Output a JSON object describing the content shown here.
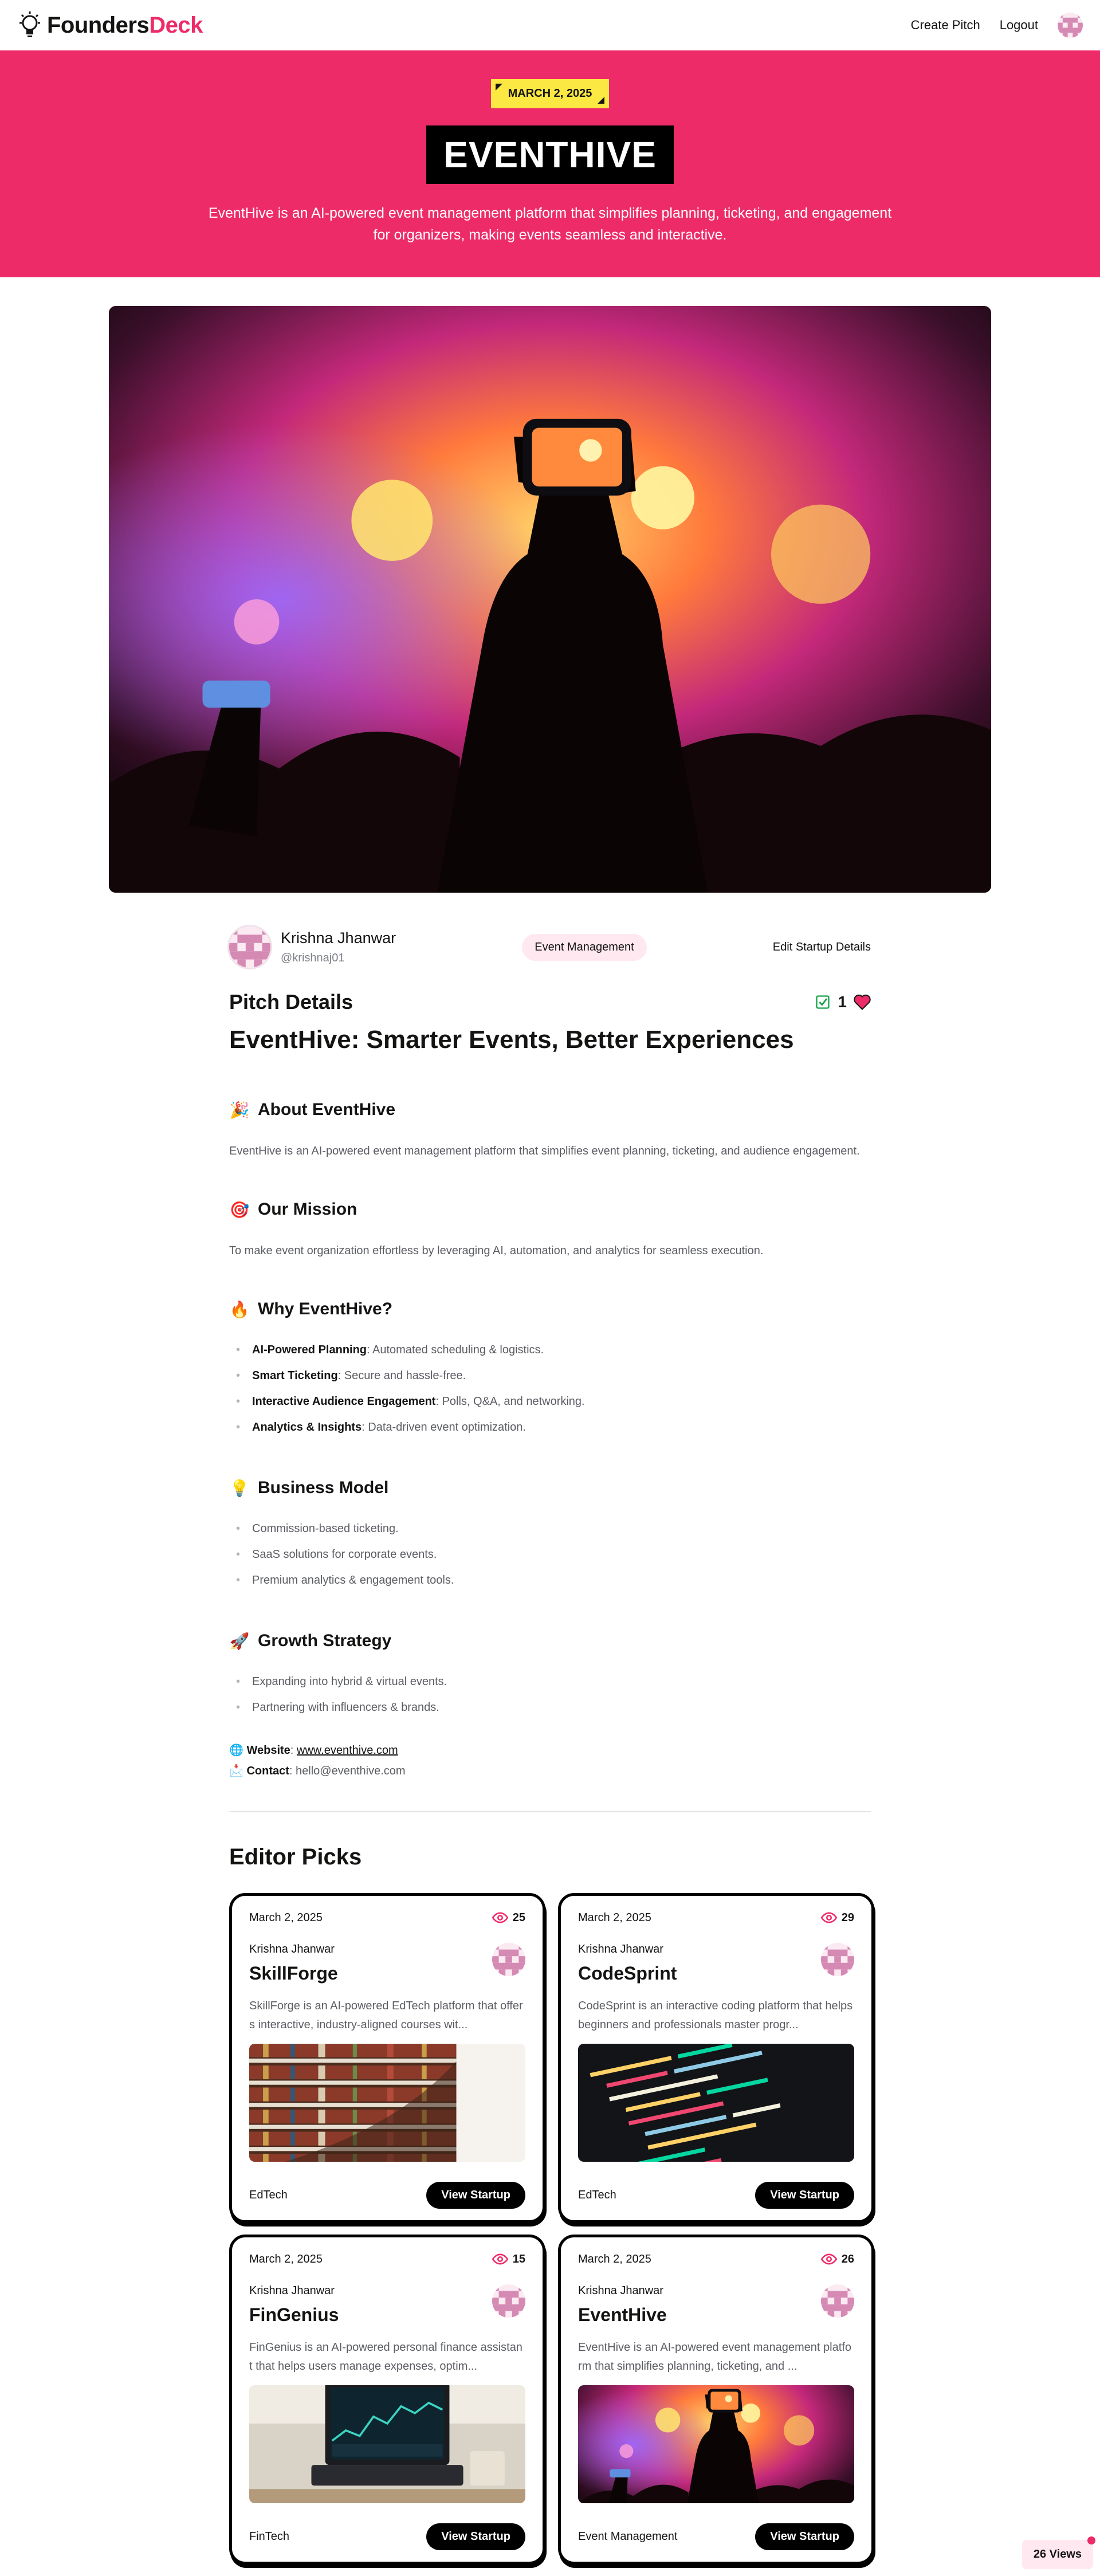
{
  "nav": {
    "logo_part1": "Founders",
    "logo_part2": "Deck",
    "create_pitch": "Create Pitch",
    "logout": "Logout"
  },
  "hero": {
    "date": "MARCH 2, 2025",
    "title": "EVENTHIVE",
    "description": "EventHive is an AI-powered event management platform that simplifies planning, ticketing, and engagement for organizers, making events seamless and interactive."
  },
  "author": {
    "name": "Krishna Jhanwar",
    "handle": "@krishnaj01",
    "category": "Event Management",
    "edit_label": "Edit Startup Details"
  },
  "pitch": {
    "heading": "Pitch Details",
    "likes": "1",
    "title": "EventHive: Smarter Events, Better Experiences",
    "about": {
      "emoji": "🎉",
      "title": "About EventHive",
      "text": "EventHive is an AI-powered event management platform that simplifies event planning, ticketing, and audience engagement."
    },
    "mission": {
      "emoji": "🎯",
      "title": "Our Mission",
      "text": "To make event organization effortless by leveraging AI, automation, and analytics for seamless execution."
    },
    "why": {
      "emoji": "🔥",
      "title": "Why EventHive?",
      "items": [
        {
          "bold": "AI-Powered Planning",
          "rest": ": Automated scheduling & logistics."
        },
        {
          "bold": "Smart Ticketing",
          "rest": ": Secure and hassle-free."
        },
        {
          "bold": "Interactive Audience Engagement",
          "rest": ": Polls, Q&A, and networking."
        },
        {
          "bold": "Analytics & Insights",
          "rest": ": Data-driven event optimization."
        }
      ]
    },
    "business": {
      "emoji": "💡",
      "title": "Business Model",
      "items": [
        "Commission-based ticketing.",
        "SaaS solutions for corporate events.",
        "Premium analytics & engagement tools."
      ]
    },
    "growth": {
      "emoji": "🚀",
      "title": "Growth Strategy",
      "items": [
        "Expanding into hybrid & virtual events.",
        "Partnering with influencers & brands."
      ]
    },
    "website_emoji": "🌐",
    "website_label": "Website",
    "website": "www.eventhive.com",
    "contact_emoji": "📩",
    "contact_label": "Contact",
    "contact": "hello@eventhive.com"
  },
  "editor_picks": {
    "title": "Editor Picks",
    "button_label": "View Startup",
    "cards": [
      {
        "date": "March 2, 2025",
        "views": "25",
        "author": "Krishna Jhanwar",
        "title": "SkillForge",
        "description": "SkillForge is an AI-powered EdTech platform that offers interactive, industry-aligned courses wit...",
        "category": "EdTech"
      },
      {
        "date": "March 2, 2025",
        "views": "29",
        "author": "Krishna Jhanwar",
        "title": "CodeSprint",
        "description": "CodeSprint is an interactive coding platform that helps beginners and professionals master progr...",
        "category": "EdTech"
      },
      {
        "date": "March 2, 2025",
        "views": "15",
        "author": "Krishna Jhanwar",
        "title": "FinGenius",
        "description": "FinGenius is an AI-powered personal finance assistant that helps users manage expenses, optim...",
        "category": "FinTech"
      },
      {
        "date": "March 2, 2025",
        "views": "26",
        "author": "Krishna Jhanwar",
        "title": "EventHive",
        "description": "EventHive is an AI-powered event management platform that simplifies planning, ticketing, and ...",
        "category": "Event Management"
      }
    ]
  },
  "views_badge": "26 Views",
  "colors": {
    "primary": "#ee2b69",
    "secondary": "#fbe843",
    "dark": "#141413"
  }
}
